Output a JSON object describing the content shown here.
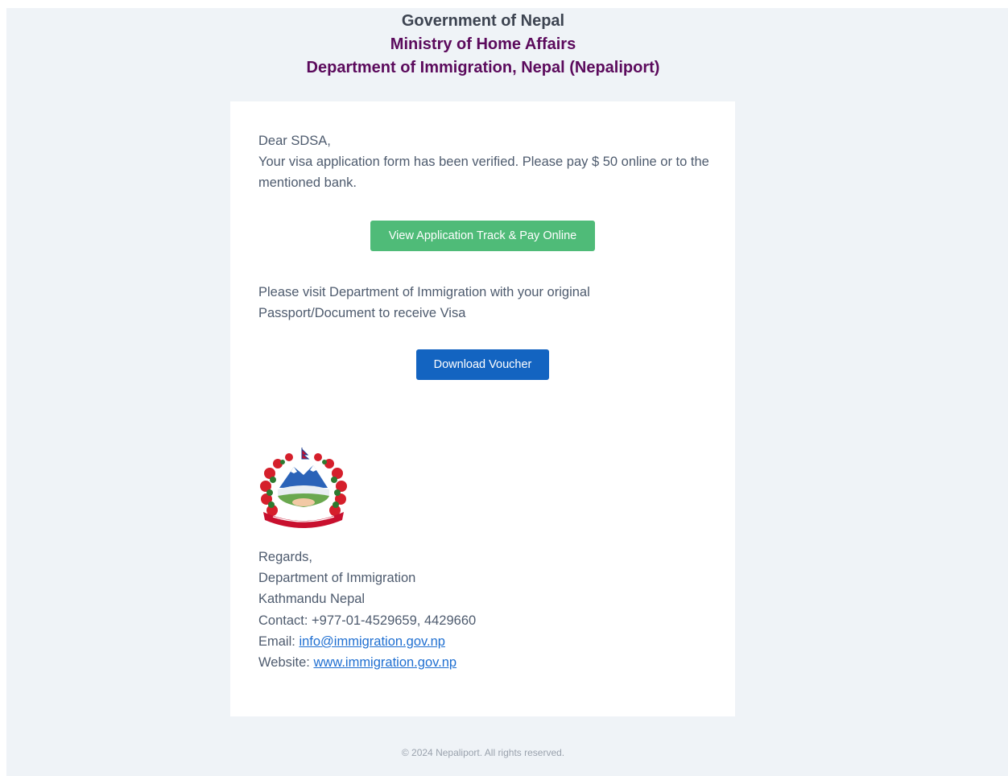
{
  "header": {
    "government": "Government of Nepal",
    "ministry": "Ministry of Home Affairs",
    "department": "Department of Immigration, Nepal (Nepaliport)"
  },
  "body": {
    "greeting": "Dear SDSA,",
    "message": "Your visa application form has been verified. Please pay $ 50 online or to the mentioned bank.",
    "track_button": "View Application Track & Pay Online",
    "visit_message": "Please visit Department of Immigration with your original Passport/Document to receive Visa",
    "voucher_button": "Download Voucher"
  },
  "emblem": {
    "icon": "nepal-emblem-icon"
  },
  "signoff": {
    "regards": "Regards,",
    "org": "Department of Immigration",
    "location": "Kathmandu Nepal",
    "contact": "Contact: +977-01-4529659, 4429660",
    "email_label": "Email: ",
    "email": "info@immigration.gov.np",
    "website_label": "Website: ",
    "website": "www.immigration.gov.np"
  },
  "footer": {
    "copyright": "© 2024 Nepaliport. All rights reserved."
  },
  "colors": {
    "background": "#eff3f7",
    "card": "#ffffff",
    "heading_dark": "#3d4451",
    "heading_purple": "#5b0a5c",
    "body_text": "#4e5b6e",
    "green_button": "#4fbb78",
    "blue_button": "#1364c1",
    "link": "#1f6fd1"
  }
}
